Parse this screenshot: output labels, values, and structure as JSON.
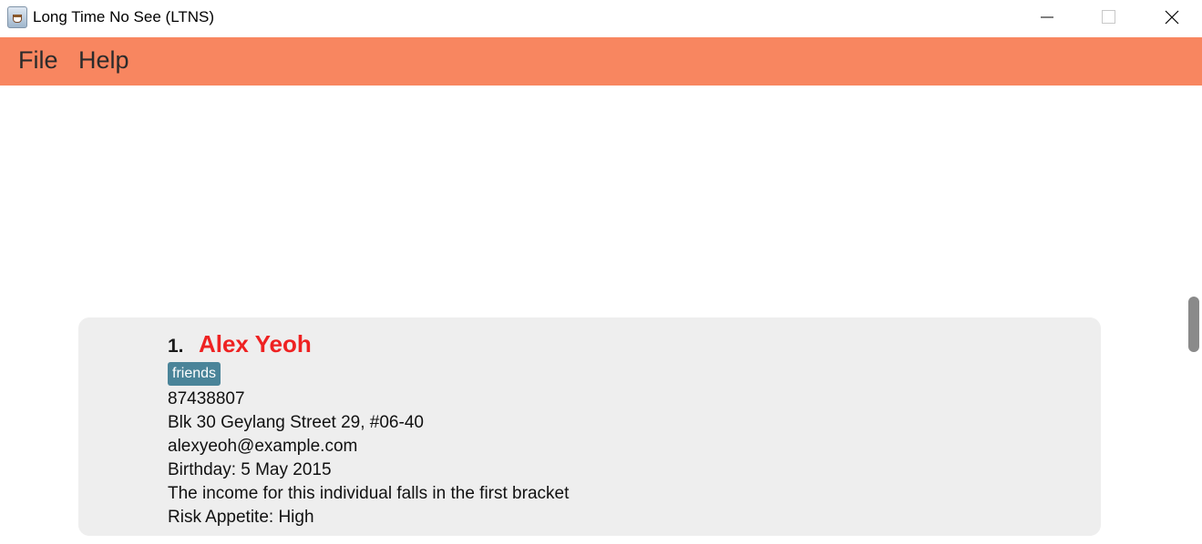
{
  "window": {
    "title": "Long Time No See (LTNS)",
    "icon": "java-coffee-cup-icon"
  },
  "menubar": {
    "items": [
      {
        "label": "File"
      },
      {
        "label": "Help"
      }
    ],
    "background": "#f88660"
  },
  "person_list": [
    {
      "index": "1.",
      "name": "Alex Yeoh",
      "tags": [
        "friends"
      ],
      "phone": "87438807",
      "address": "Blk 30 Geylang Street 29, #06-40",
      "email": "alexyeoh@example.com",
      "birthday": "Birthday: 5 May 2015",
      "income": "The income for this individual falls in the first bracket",
      "risk_appetite": "Risk Appetite: High"
    }
  ],
  "colors": {
    "name": "#ee2222",
    "tag": "#4a8499",
    "card": "#eeeeee"
  }
}
